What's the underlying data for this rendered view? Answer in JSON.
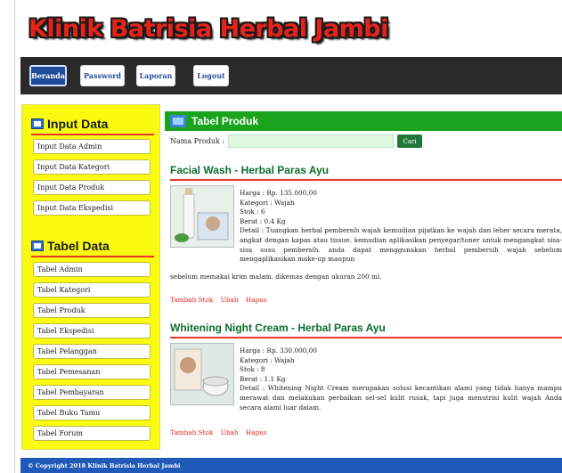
{
  "logo": {
    "text": "Klinik Batrisia Herbal Jambi"
  },
  "nav": {
    "items": [
      {
        "label": "Beranda",
        "active": true
      },
      {
        "label": "Password",
        "active": false
      },
      {
        "label": "Laporan",
        "active": false
      },
      {
        "label": "Logout",
        "active": false
      }
    ]
  },
  "sidebar": {
    "input_title": "Input Data",
    "input_items": [
      "Input Data Admin",
      "Input Data Kategori",
      "Input Data Produk",
      "Input Data Ekspedisi"
    ],
    "table_title": "Tabel Data",
    "table_items": [
      "Tabel Admin",
      "Tabel Kategori",
      "Tabel Produk",
      "Tabel Ekspedisi",
      "Tabel Pelanggan",
      "Tabel Pemesanan",
      "Tabel Pembayaran",
      "Tabel Buku Tamu",
      "Tabel Forum"
    ]
  },
  "main": {
    "title": "Tabel Produk",
    "search_label": "Nama Produk :",
    "search_value": "",
    "search_button": "Cari"
  },
  "products": [
    {
      "name": "Facial Wash - Herbal Paras Ayu",
      "harga": "Harga : Rp. 135.000,00",
      "kategori": "Kategori : Wajah",
      "stok": "Stok : 6",
      "berat": "Berat : 0.4 Kg",
      "detail": "Detail : Tuangkan herbal pembersih wajah kemudian pijatkan ke wajah dan leher secara merata, angkat dengan kapas atau tissue. kemudian aplikasikan penyegar/toner untuk mengangkat sisa-sisa susu pembersih. anda dapat menggunakan herbal pembersih wajah sebelum mengaplikasikan make-up maupun",
      "detail_cont": "sebelum memakai krim malam. dikemas dengan ukuran 200 ml."
    },
    {
      "name": "Whitening Night Cream - Herbal Paras Ayu",
      "harga": "Harga : Rp. 330.000,00",
      "kategori": "Kategori : Wajah",
      "stok": "Stok : 8",
      "berat": "Berat : 1.1 Kg",
      "detail": "Detail : Whitening Night Cream merupakan solusi kecantikan alami yang tidak hanya mampu merawat dan melakukan perbaikan sel-sel kulit rusak, tapi juga menutrisi kulit wajah Anda secara alami luar dalam.",
      "detail_cont": ""
    }
  ],
  "actions": {
    "add_stock": "Tambah Stok",
    "edit": "Ubah",
    "delete": "Hapus"
  },
  "footer": {
    "text": "© Copyright 2018 Klinik Batrisia Herbal Jambi"
  }
}
